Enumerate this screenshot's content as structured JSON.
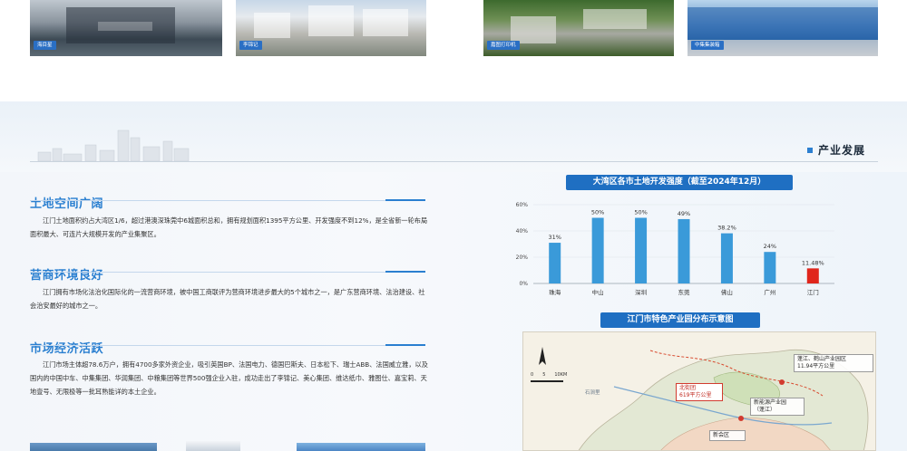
{
  "top_photos": [
    {
      "caption": "海目星"
    },
    {
      "caption": "李锦记"
    },
    {
      "caption": "嘉图打印机"
    },
    {
      "caption": "中集集装箱"
    }
  ],
  "section": {
    "label": "产业发展"
  },
  "blocks": [
    {
      "heading": "土地空间广阔",
      "text": "江门土地面积约占大湾区1/6，超过港澳深珠莞中6城面积总和，拥有规划面积1395平方公里、开发强度不到12%，是全省新一轮布局面积最大、可连片大规模开发的产业集聚区。"
    },
    {
      "heading": "营商环境良好",
      "text": "江门拥有市场化法治化国际化的一流营商环境，被中国工商联评为营商环境进步最大的5个城市之一，是广东营商环境、法治建设、社会治安最好的城市之一。"
    },
    {
      "heading": "市场经济活跃",
      "text": "江门市场主体超78.6万户，拥有4700多家外资企业，吸引英国BP、法国电力、德国巴斯夫、日本松下、瑞士ABB、法国威立雅，以及国内的中国中车、中集集团、华润集团、中粮集团等世界500强企业入驻，成功走出了李锦记、美心集团、维达纸巾、雅图仕、嘉宝莉、天地壹号、无限极等一批耳熟能详的本土企业。"
    }
  ],
  "chart_titles": {
    "chart": "大湾区各市土地开发强度（截至2024年12月）",
    "map": "江门市特色产业园分布示意图"
  },
  "chart_data": {
    "type": "bar",
    "title": "大湾区各市土地开发强度（截至2024年12月）",
    "categories": [
      "珠海",
      "中山",
      "深圳",
      "东莞",
      "佛山",
      "广州",
      "江门"
    ],
    "values": [
      31,
      50,
      50,
      49,
      38.2,
      24,
      11.48
    ],
    "value_labels": [
      "31%",
      "50%",
      "50%",
      "49%",
      "38.2%",
      "24%",
      "11.48%"
    ],
    "y_ticks": [
      "0%",
      "20%",
      "40%",
      "60%"
    ],
    "ylim": [
      0,
      60
    ],
    "grid": true,
    "colors": {
      "default": "#3a9ad9",
      "highlight": "#e0261c"
    },
    "highlight_category": "江门"
  },
  "map": {
    "scale_labels": [
      "0",
      "5",
      "10KM"
    ],
    "place_label": "石涧里",
    "callouts": [
      {
        "text": "北街团\n619平方公里"
      },
      {
        "text": "蓬江、鹤山产业园区\n11.94平方公里"
      },
      {
        "text": "新能源产业园\n（蓬江）"
      },
      {
        "text": "新会区"
      }
    ]
  }
}
